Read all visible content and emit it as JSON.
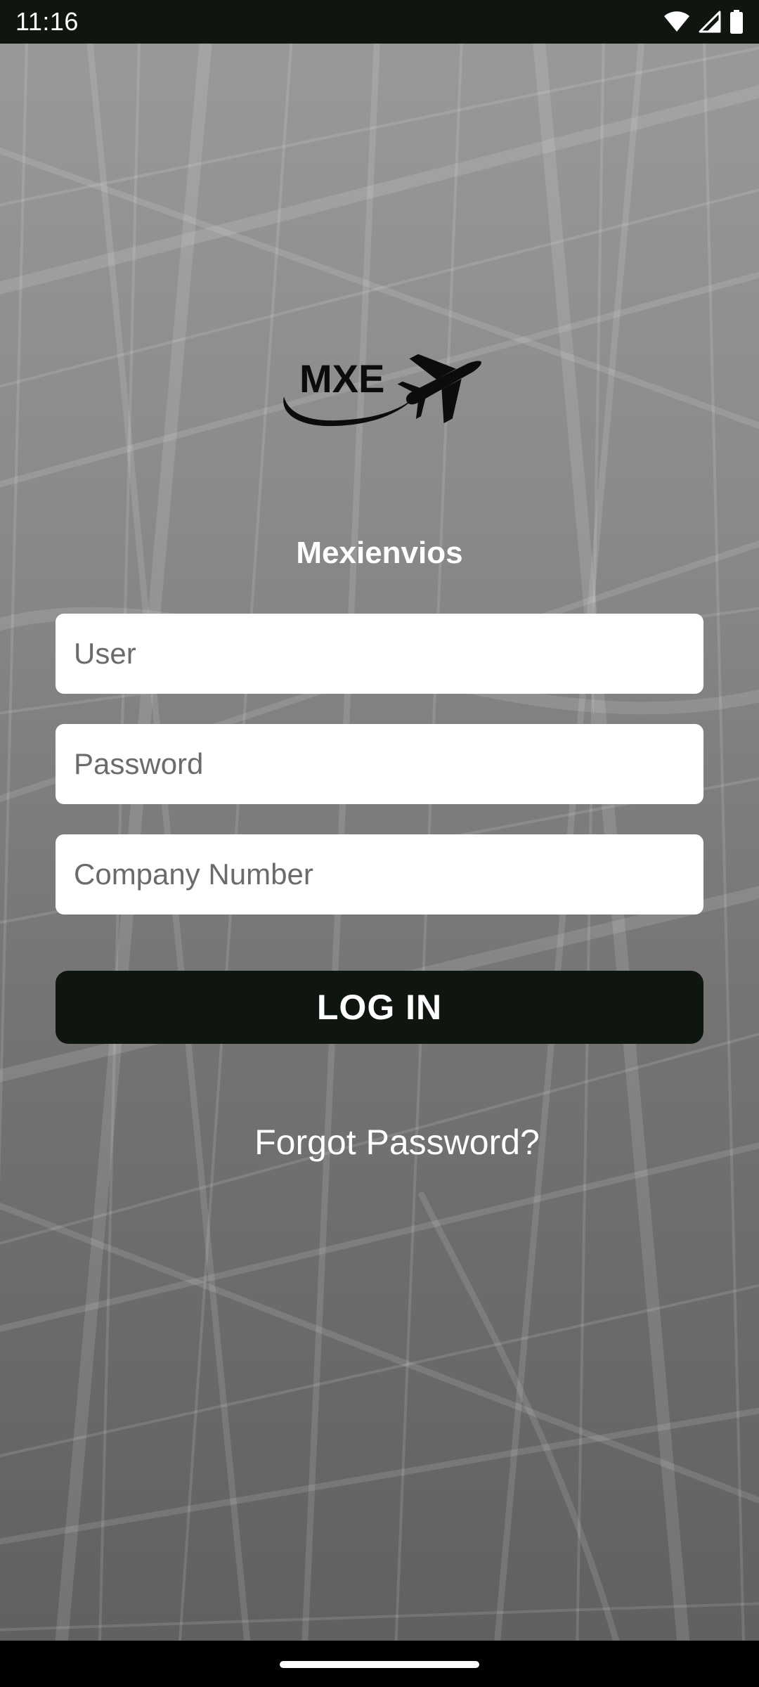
{
  "status_bar": {
    "time": "11:16",
    "icons": [
      "wifi-icon",
      "cellular-signal-icon",
      "battery-icon"
    ]
  },
  "logo": {
    "text": "MXE",
    "icon": "airplane-icon"
  },
  "app": {
    "name": "Mexienvios"
  },
  "form": {
    "user": {
      "value": "",
      "placeholder": "User"
    },
    "password": {
      "value": "",
      "placeholder": "Password"
    },
    "company_number": {
      "value": "",
      "placeholder": "Company Number"
    },
    "login_label": "LOG IN",
    "forgot_label": "Forgot Password?"
  },
  "colors": {
    "dark_accent": "#0f1610",
    "text_on_dark": "#ffffff",
    "background_top": "#9a9a9a",
    "background_bottom": "#5f5f60"
  }
}
